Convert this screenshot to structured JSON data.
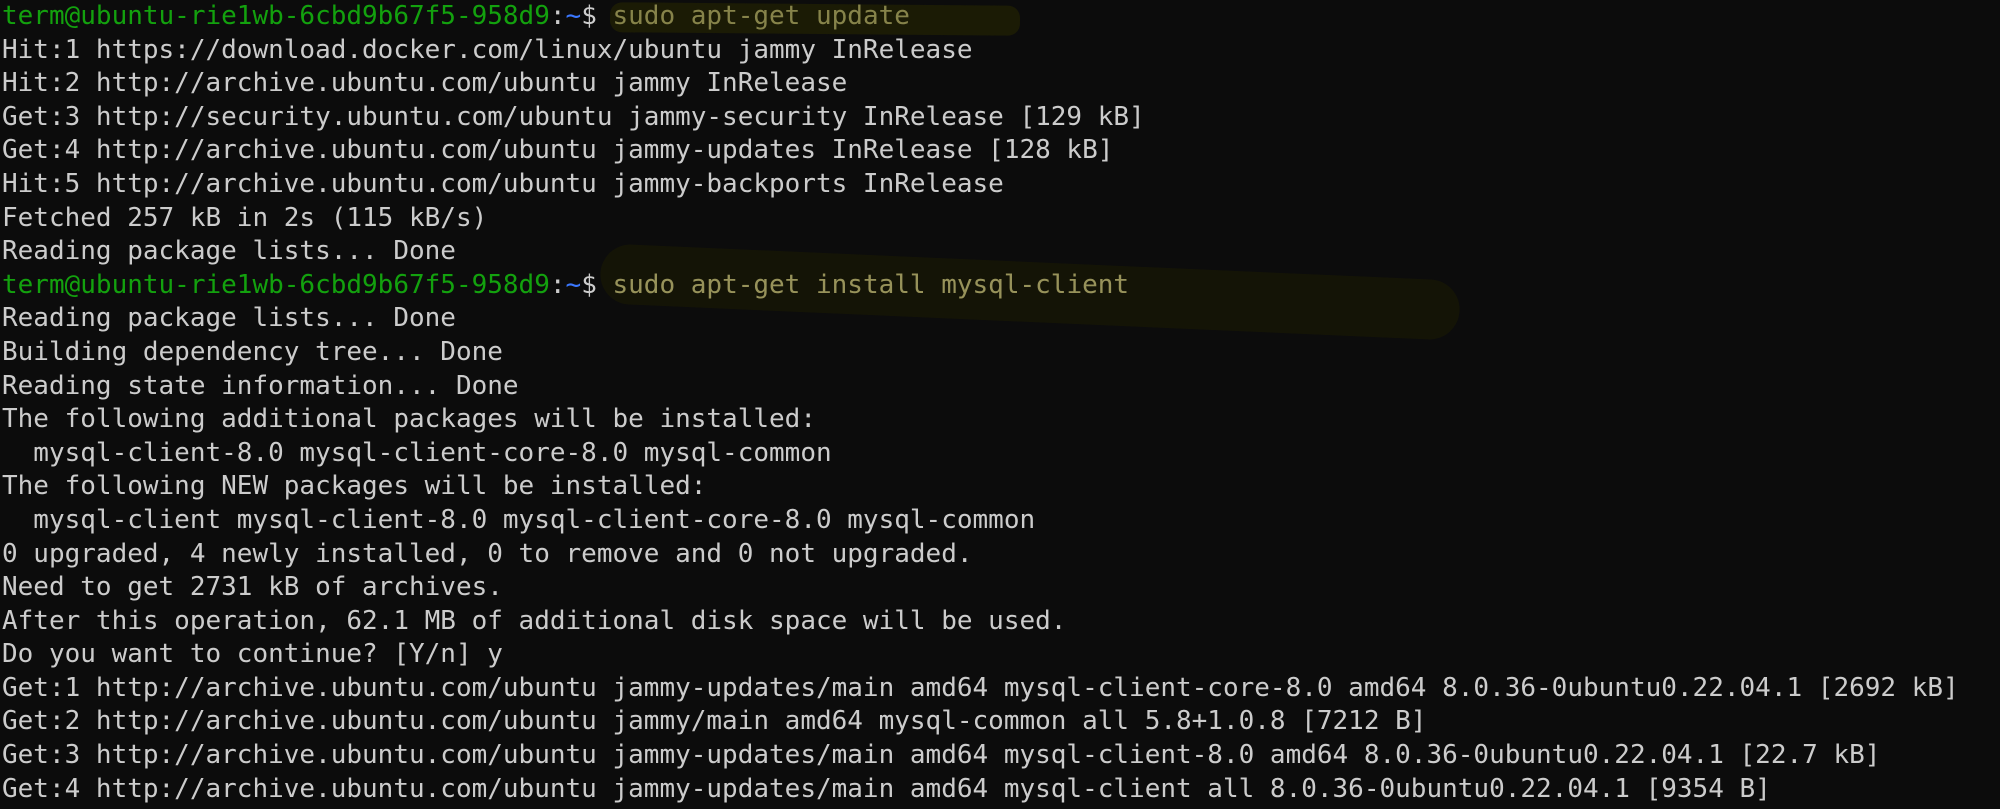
{
  "terminal": {
    "colors": {
      "background": "#0c0c0c",
      "text": "#cccccc",
      "prompt_user": "#13a10e",
      "prompt_path": "#3b78ff",
      "command": "#f9f1a5"
    },
    "prompt": {
      "user_host": "term@ubuntu-rie1wb-6cbd9b67f5-958d9",
      "separator": ":",
      "path": "~",
      "symbol": "$"
    },
    "lines": [
      {
        "type": "prompt",
        "command": " sudo apt-get update"
      },
      {
        "type": "out",
        "text": "Hit:1 https://download.docker.com/linux/ubuntu jammy InRelease"
      },
      {
        "type": "out",
        "text": "Hit:2 http://archive.ubuntu.com/ubuntu jammy InRelease"
      },
      {
        "type": "out",
        "text": "Get:3 http://security.ubuntu.com/ubuntu jammy-security InRelease [129 kB]"
      },
      {
        "type": "out",
        "text": "Get:4 http://archive.ubuntu.com/ubuntu jammy-updates InRelease [128 kB]"
      },
      {
        "type": "out",
        "text": "Hit:5 http://archive.ubuntu.com/ubuntu jammy-backports InRelease"
      },
      {
        "type": "out",
        "text": "Fetched 257 kB in 2s (115 kB/s)"
      },
      {
        "type": "out",
        "text": "Reading package lists... Done"
      },
      {
        "type": "prompt",
        "command": " sudo apt-get install mysql-client"
      },
      {
        "type": "out",
        "text": "Reading package lists... Done"
      },
      {
        "type": "out",
        "text": "Building dependency tree... Done"
      },
      {
        "type": "out",
        "text": "Reading state information... Done"
      },
      {
        "type": "out",
        "text": "The following additional packages will be installed:"
      },
      {
        "type": "out",
        "text": "  mysql-client-8.0 mysql-client-core-8.0 mysql-common"
      },
      {
        "type": "out",
        "text": "The following NEW packages will be installed:"
      },
      {
        "type": "out",
        "text": "  mysql-client mysql-client-8.0 mysql-client-core-8.0 mysql-common"
      },
      {
        "type": "out",
        "text": "0 upgraded, 4 newly installed, 0 to remove and 0 not upgraded."
      },
      {
        "type": "out",
        "text": "Need to get 2731 kB of archives."
      },
      {
        "type": "out",
        "text": "After this operation, 62.1 MB of additional disk space will be used."
      },
      {
        "type": "out",
        "text": "Do you want to continue? [Y/n] y"
      },
      {
        "type": "out",
        "text": "Get:1 http://archive.ubuntu.com/ubuntu jammy-updates/main amd64 mysql-client-core-8.0 amd64 8.0.36-0ubuntu0.22.04.1 [2692 kB]"
      },
      {
        "type": "out",
        "text": "Get:2 http://archive.ubuntu.com/ubuntu jammy/main amd64 mysql-common all 5.8+1.0.8 [7212 B]"
      },
      {
        "type": "out",
        "text": "Get:3 http://archive.ubuntu.com/ubuntu jammy-updates/main amd64 mysql-client-8.0 amd64 8.0.36-0ubuntu0.22.04.1 [22.7 kB]"
      },
      {
        "type": "out",
        "text": "Get:4 http://archive.ubuntu.com/ubuntu jammy-updates/main amd64 mysql-client all 8.0.36-0ubuntu0.22.04.1 [9354 B]"
      }
    ]
  }
}
